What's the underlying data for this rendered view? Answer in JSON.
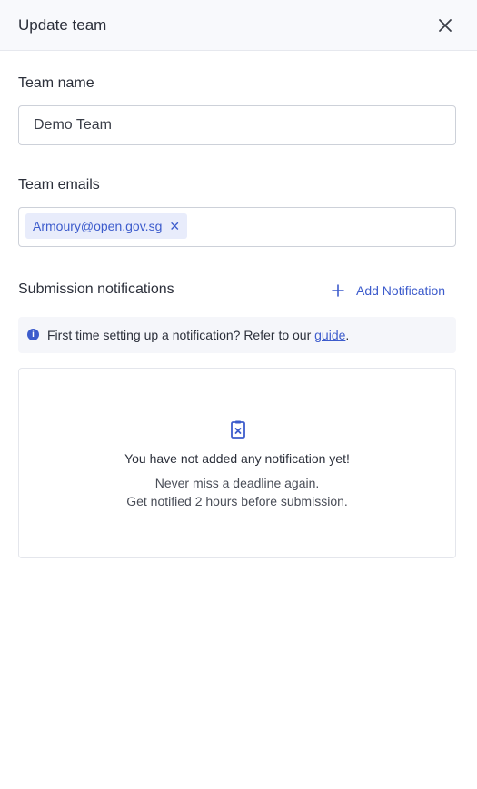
{
  "header": {
    "title": "Update team"
  },
  "team_name": {
    "label": "Team name",
    "value": "Demo Team"
  },
  "team_emails": {
    "label": "Team emails",
    "tags": [
      "Armoury@open.gov.sg"
    ],
    "tag_remove": "✕"
  },
  "notifications": {
    "title": "Submission notifications",
    "add_label": "Add Notification",
    "info_text": "First time setting up a notification? Refer to our ",
    "info_link": "guide",
    "info_suffix": ".",
    "empty_title": "You have not added any notification yet!",
    "empty_line1": "Never miss a deadline again.",
    "empty_line2": "Get notified 2 hours before submission."
  },
  "icons": {
    "close": "close-icon",
    "plus": "plus-icon",
    "info": "info-icon",
    "empty": "clipboard-x-icon"
  },
  "colors": {
    "accent": "#3d5ccc",
    "header_bg": "#f8f9fc",
    "tag_bg": "#e8ecfb"
  }
}
